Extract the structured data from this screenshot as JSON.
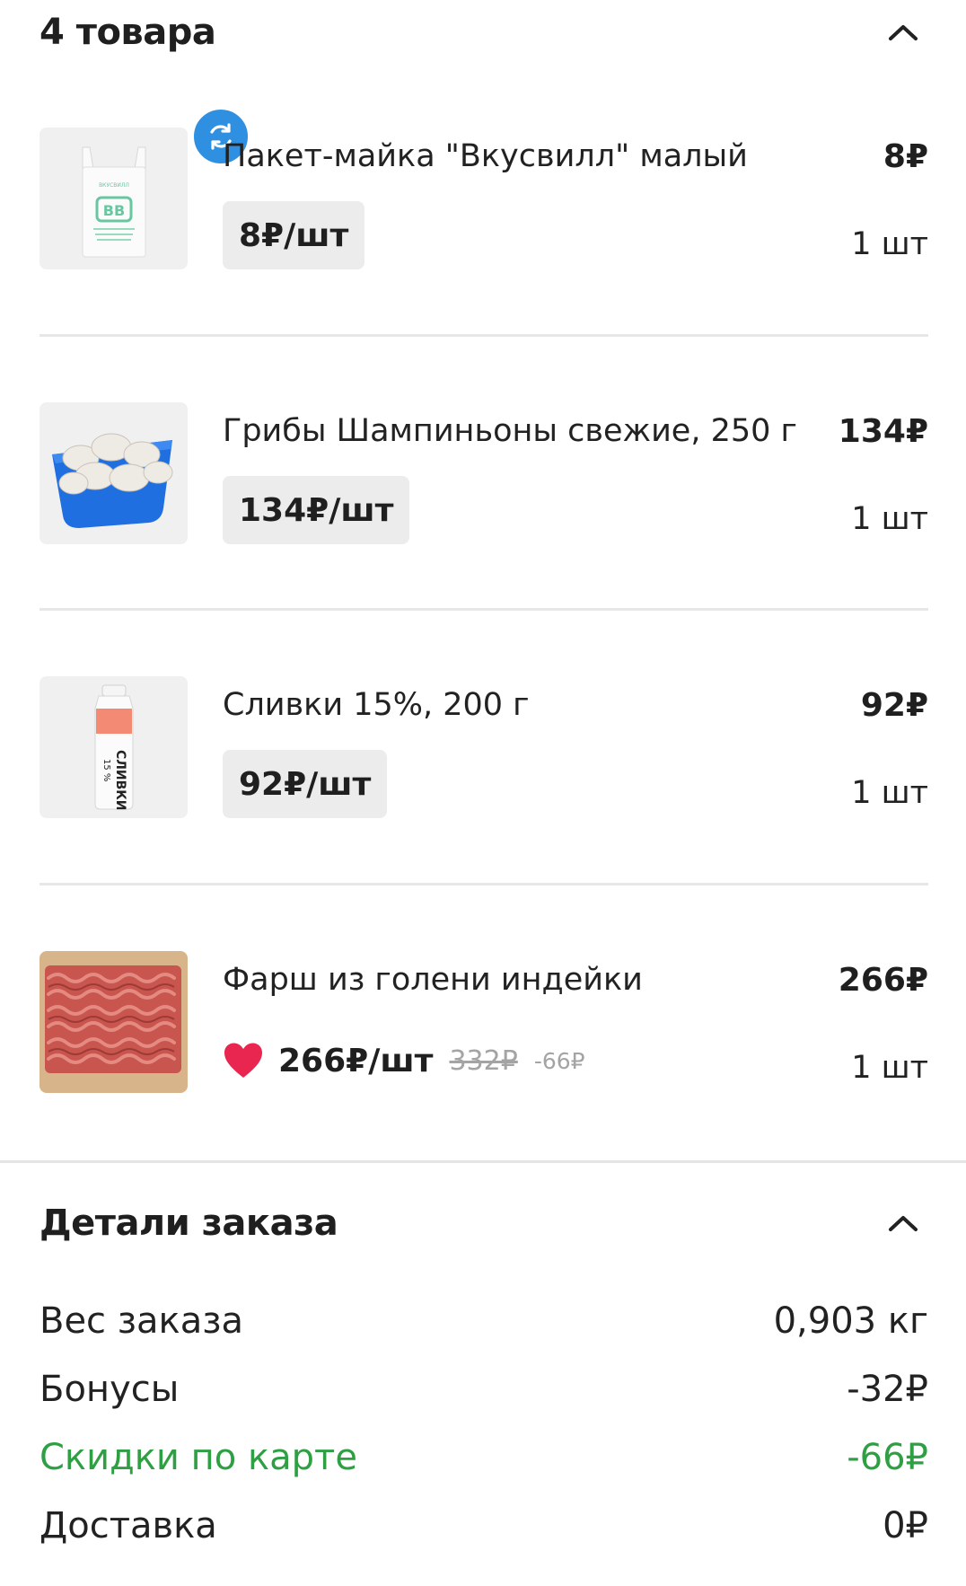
{
  "items_header": {
    "title": "4 товара",
    "chevron": "chevron-up-icon"
  },
  "items": [
    {
      "name": "Пакет-майка \"Вкусвилл\" малый",
      "total": "8₽",
      "unit_price": "8₽/шт",
      "qty": "1 шт",
      "image": "bag-image",
      "badge_icon": "sync-icon",
      "bag_logo": "ВВ",
      "bag_brand": "ВКУСВИЛЛ"
    },
    {
      "name": "Грибы Шампиньоны свежие, 250 г",
      "total": "134₽",
      "unit_price": "134₽/шт",
      "qty": "1 шт",
      "image": "mushrooms-image"
    },
    {
      "name": "Сливки 15%, 200 г",
      "total": "92₽",
      "unit_price": "92₽/шт",
      "qty": "1 шт",
      "image": "cream-bottle-image",
      "bottle_label": "СЛИВКИ",
      "bottle_percent": "15 %"
    },
    {
      "name": "Фарш из голени индейки",
      "total": "266₽",
      "unit_price": "266₽/шт",
      "old_price": "332₽",
      "discount": "-66₽",
      "qty": "1 шт",
      "image": "minced-meat-image",
      "promo_icon": "heart-icon"
    }
  ],
  "order_details": {
    "title": "Детали заказа",
    "chevron": "chevron-up-icon",
    "rows": [
      {
        "label": "Вес заказа",
        "value": "0,903 кг"
      },
      {
        "label": "Бонусы",
        "value": "-32₽"
      },
      {
        "label": "Скидки по карте",
        "value": "-66₽"
      },
      {
        "label": "Доставка",
        "value": "0₽"
      }
    ]
  },
  "colors": {
    "accent_green": "#2ea043",
    "badge_blue": "#2f8fe0",
    "heart_red": "#e8264f",
    "pill_bg": "#ececec",
    "muted": "#a4a4a4"
  }
}
